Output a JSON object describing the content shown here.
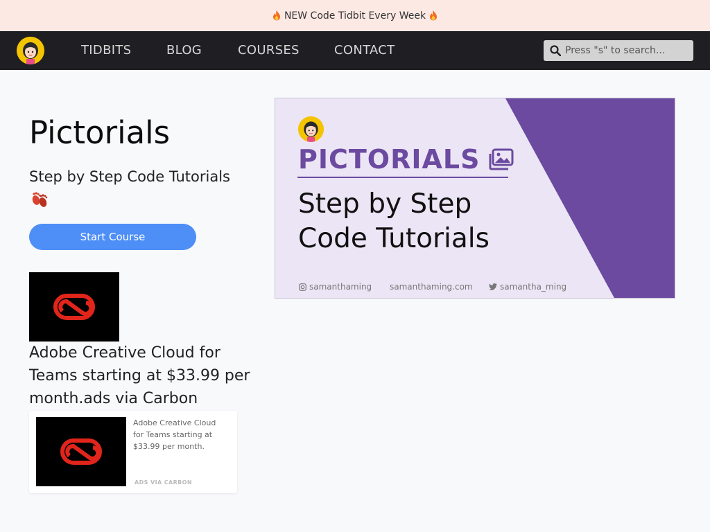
{
  "banner": {
    "text": "NEW Code Tidbit Every Week"
  },
  "nav": {
    "links": [
      "TIDBITS",
      "BLOG",
      "COURSES",
      "CONTACT"
    ],
    "search_placeholder": "Press \"s\" to search..."
  },
  "main": {
    "title": "Pictorials",
    "subtitle": "Step by Step Code Tutorials",
    "start_button": "Start Course"
  },
  "ad": {
    "headline": "Adobe Creative Cloud for Teams starting at $33.99 per month.ads via Carbon",
    "card_text": "Adobe Creative Cloud for Teams starting at $33.99 per month.",
    "card_via": "ADS VIA CARBON"
  },
  "hero": {
    "brand": "PICTORIALS",
    "line1": "Step by Step",
    "line2": "Code Tutorials",
    "instagram": "samanthaming",
    "website": "samanthaming.com",
    "twitter": "samantha_ming"
  },
  "colors": {
    "banner_bg": "#fce9e4",
    "nav_bg": "#1f1f23",
    "accent_blue": "#4d8ef7",
    "brand_purple": "#6b4aa0",
    "hero_bg": "#ebe5f5",
    "adobe_red": "#e1251b"
  },
  "icons": [
    "flame-icon",
    "avatar-logo",
    "search-icon",
    "footprints-icon",
    "adobe-cc-logo",
    "gallery-icon",
    "instagram-icon",
    "twitter-icon"
  ]
}
